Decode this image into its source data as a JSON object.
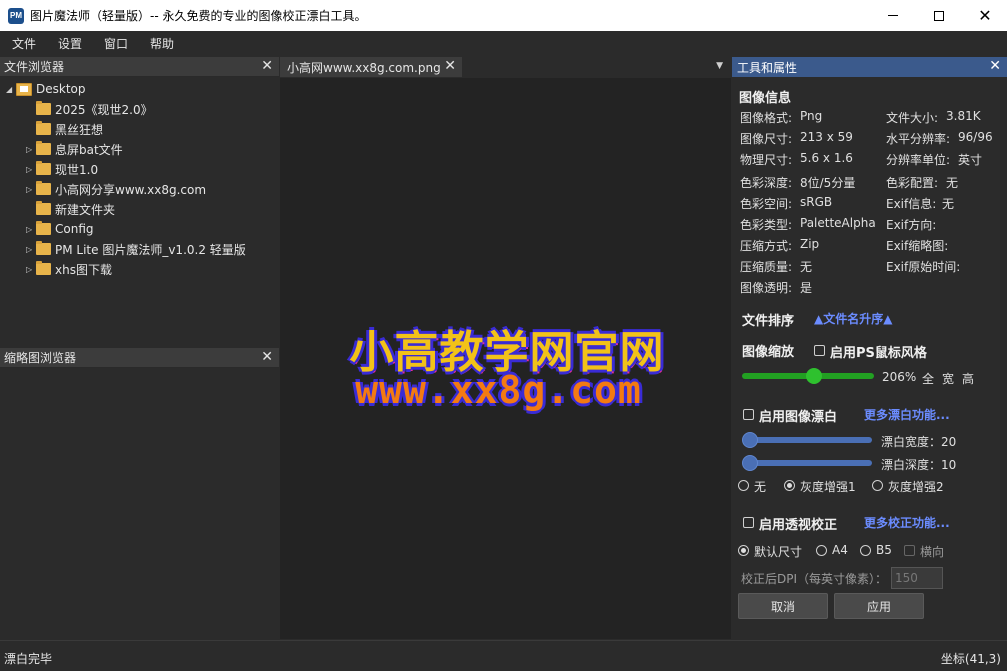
{
  "window": {
    "app_icon_text": "PM",
    "title": "图片魔法师（轻量版）--  永久免费的专业的图像校正漂白工具。"
  },
  "menu": [
    "文件",
    "设置",
    "窗口",
    "帮助"
  ],
  "file_browser": {
    "title": "文件浏览器",
    "root": "Desktop",
    "items": [
      {
        "label": "2025《现世2.0》",
        "expandable": false
      },
      {
        "label": "黑丝狂想",
        "expandable": false
      },
      {
        "label": "息屏bat文件",
        "expandable": true
      },
      {
        "label": "现世1.0",
        "expandable": true
      },
      {
        "label": "小高网分享www.xx8g.com",
        "expandable": true
      },
      {
        "label": "新建文件夹",
        "expandable": false
      },
      {
        "label": "Config",
        "expandable": true
      },
      {
        "label": "PM Lite 图片魔法师_v1.0.2 轻量版",
        "expandable": true
      },
      {
        "label": "xhs图下载",
        "expandable": true
      }
    ]
  },
  "thumbnail_browser": {
    "title": "缩略图浏览器"
  },
  "tab": {
    "label": "小高网www.xx8g.com.png"
  },
  "image": {
    "line1": "小高教学网官网",
    "line2": "www.xx8g.com"
  },
  "properties": {
    "title": "工具和属性",
    "info_heading": "图像信息",
    "info_left": [
      {
        "label": "图像格式:",
        "value": "Png"
      },
      {
        "label": "图像尺寸:",
        "value": "213 x 59"
      },
      {
        "label": "物理尺寸:",
        "value": "5.6 x 1.6"
      },
      {
        "label": "色彩深度:",
        "value": "8位/5分量"
      },
      {
        "label": "色彩空间:",
        "value": "sRGB"
      },
      {
        "label": "色彩类型:",
        "value": "PaletteAlpha"
      },
      {
        "label": "压缩方式:",
        "value": "Zip"
      },
      {
        "label": "压缩质量:",
        "value": "无"
      },
      {
        "label": "图像透明:",
        "value": "是"
      }
    ],
    "info_right": [
      {
        "label": "文件大小:",
        "value": "3.81K"
      },
      {
        "label": "水平分辨率:",
        "value": "96/96"
      },
      {
        "label": "分辨率单位:",
        "value": "英寸"
      },
      {
        "label": "色彩配置:",
        "value": "无"
      },
      {
        "label": "Exif信息:",
        "value": "无"
      },
      {
        "label": "Exif方向:",
        "value": ""
      },
      {
        "label": "Exif缩略图:",
        "value": ""
      },
      {
        "label": "Exif原始时间:",
        "value": ""
      }
    ],
    "sort_label": "文件排序",
    "sort_value": "▲文件名升序▲",
    "zoom_label": "图像缩放",
    "zoom_ps_checkbox": "启用PS鼠标风格",
    "zoom_value": "206%",
    "zoom_level": 0.55,
    "zoom_full": "全",
    "zoom_width": "宽",
    "zoom_height": "高",
    "whiten_checkbox": "启用图像漂白",
    "whiten_more": "更多漂白功能...",
    "whiten_width_label": "漂白宽度：20",
    "whiten_depth_label": "漂白深度：10",
    "radio_none": "无",
    "radio_gray1": "灰度增强1",
    "radio_gray2": "灰度增强2",
    "perspective_checkbox": "启用透视校正",
    "perspective_more": "更多校正功能...",
    "size_default": "默认尺寸",
    "size_a4": "A4",
    "size_b5": "B5",
    "landscape": "横向",
    "dpi_label": "校正后DPI（每英寸像素）：",
    "dpi_value": "150",
    "cancel_button": "取消",
    "apply_button": "应用"
  },
  "status": {
    "left": "漂白完毕",
    "right": "坐标(41,3)"
  },
  "colors": {
    "accent_header": "#3b5a8c",
    "zoom_slider": "#22a022",
    "whiten_slider": "#4a6fb5",
    "link": "#6b8cff",
    "folder": "#e8b44a"
  }
}
